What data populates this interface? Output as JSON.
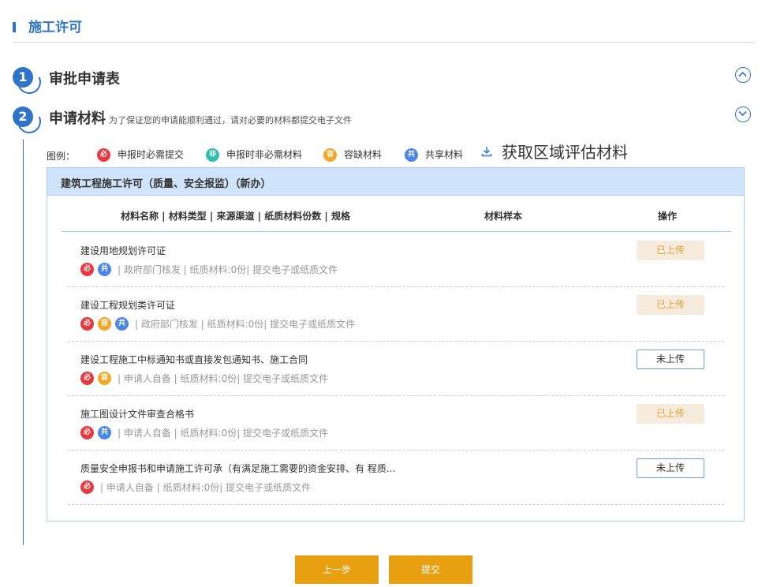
{
  "page": {
    "title": "施工许可"
  },
  "steps": [
    {
      "num": "1",
      "title": "审批申请表",
      "note": ""
    },
    {
      "num": "2",
      "title": "申请材料",
      "note": "为了保证您的申请能顺利通过，请对必要的材料都提交电子文件"
    }
  ],
  "legend": {
    "label": "图例：",
    "items": [
      {
        "badge": "必",
        "text": "申报时必需提交",
        "color": "#e8383d"
      },
      {
        "badge": "非",
        "text": "申报时非必需材料",
        "color": "#2bbfae"
      },
      {
        "badge": "容",
        "text": "容缺材料",
        "color": "#f5a623"
      },
      {
        "badge": "共",
        "text": "共享材料",
        "color": "#4a86e8"
      }
    ],
    "download_text": "获取区域评估材料"
  },
  "panel": {
    "title": "建筑工程施工许可（质量、安全报监）（新办）",
    "headers": {
      "name": "材料名称 | 材料类型 | 来源渠道 | 纸质材料份数 | 规格",
      "sample": "材料样本",
      "action": "操作"
    },
    "rows": [
      {
        "name": "建设用地规划许可证",
        "badges": [
          "必",
          "共"
        ],
        "meta": "| 政府部门核发 | 纸质材料:0份| 提交电子或纸质文件",
        "button": "已上传",
        "status": "uploaded"
      },
      {
        "name": "建设工程规划类许可证",
        "badges": [
          "必",
          "容",
          "共"
        ],
        "meta": "| 政府部门核发 | 纸质材料:0份| 提交电子或纸质文件",
        "button": "已上传",
        "status": "uploaded"
      },
      {
        "name": "建设工程施工中标通知书或直接发包通知书、施工合同",
        "badges": [
          "必",
          "容"
        ],
        "meta": "| 申请人自备 | 纸质材料:0份| 提交电子或纸质文件",
        "button": "未上传",
        "status": "pending"
      },
      {
        "name": "施工图设计文件审查合格书",
        "badges": [
          "必",
          "共"
        ],
        "meta": "| 申请人自备 | 纸质材料:0份| 提交电子或纸质文件",
        "button": "已上传",
        "status": "uploaded"
      },
      {
        "name": "质量安全申报书和申请施工许可承（有满足施工需要的资金安排、有 程质...",
        "badges": [
          "必"
        ],
        "meta": "| 申请人自备 | 纸质材料:0份| 提交电子或纸质文件",
        "button": "未上传",
        "status": "pending"
      }
    ]
  },
  "footer": {
    "prev_label": "上一步",
    "submit_label": "提交"
  },
  "colors": {
    "accent": "#2f74c8",
    "button": "#e8a010",
    "uploaded_bg": "#f6ebdc",
    "uploaded_text": "#e8a03a"
  }
}
